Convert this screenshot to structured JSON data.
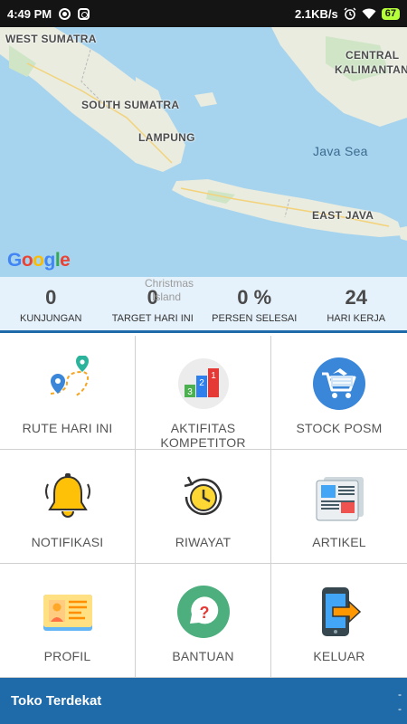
{
  "status_bar": {
    "time": "4:49 PM",
    "speed": "2.1KB/s",
    "battery": "67",
    "icons": [
      "notification-dot-icon",
      "instagram-icon",
      "alarm-icon",
      "wifi-icon",
      "battery-icon"
    ]
  },
  "map": {
    "labels": {
      "west_sumatra": "WEST SUMATRA",
      "central_kalimantan_1": "CENTRAL",
      "central_kalimantan_2": "KALIMANTAN",
      "south_sumatra": "SOUTH SUMATRA",
      "lampung": "LAMPUNG",
      "java_sea": "Java Sea",
      "east_java": "EAST JAVA",
      "christmas_1": "Christmas",
      "christmas_2": "Island"
    },
    "logo": [
      "G",
      "o",
      "o",
      "g",
      "l",
      "e"
    ]
  },
  "stats": [
    {
      "value": "0",
      "label": "KUNJUNGAN"
    },
    {
      "value": "0",
      "label": "TARGET HARI INI"
    },
    {
      "value": "0 %",
      "label": "PERSEN SELESAI"
    },
    {
      "value": "24",
      "label": "HARI KERJA"
    }
  ],
  "menu": [
    {
      "label": "RUTE HARI INI",
      "icon": "route-icon"
    },
    {
      "label": "AKTIFITAS\nKOMPETITOR",
      "icon": "podium-icon"
    },
    {
      "label": "STOCK POSM",
      "icon": "shopping-cart-icon"
    },
    {
      "label": "NOTIFIKASI",
      "icon": "bell-icon"
    },
    {
      "label": "RIWAYAT",
      "icon": "history-clock-icon"
    },
    {
      "label": "ARTIKEL",
      "icon": "newspaper-icon"
    },
    {
      "label": "PROFIL",
      "icon": "id-card-icon"
    },
    {
      "label": "BANTUAN",
      "icon": "help-bubble-icon"
    },
    {
      "label": "KELUAR",
      "icon": "logout-phone-icon"
    }
  ],
  "bottom_bar": {
    "title": "Toko Terdekat",
    "dash_1": "-",
    "dash_2": "-"
  },
  "colors": {
    "primary": "#1f6aa8",
    "stats_bg": "#e6f2fb",
    "map_water": "#a6d3ee"
  }
}
